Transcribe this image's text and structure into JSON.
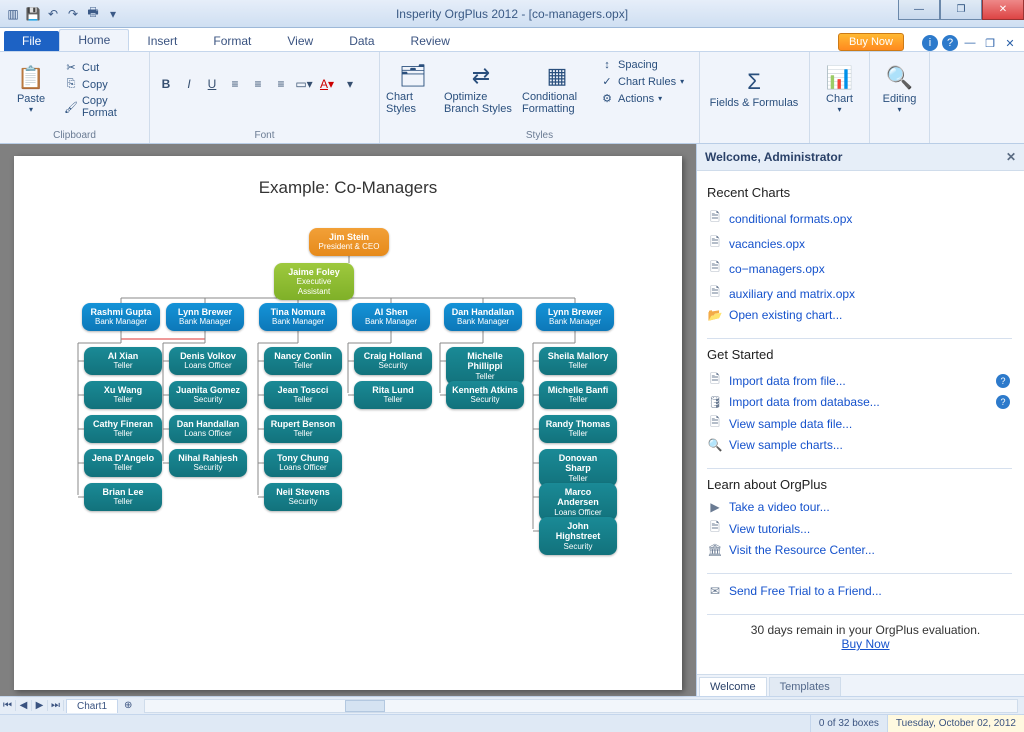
{
  "app_title": "Insperity OrgPlus 2012 - [co-managers.opx]",
  "qat": [
    "app",
    "save",
    "undo",
    "redo",
    "print"
  ],
  "menu": {
    "file": "File",
    "tabs": [
      "Home",
      "Insert",
      "Format",
      "View",
      "Data",
      "Review"
    ],
    "active": 0,
    "buy": "Buy Now"
  },
  "ribbon": {
    "clipboard": {
      "label": "Clipboard",
      "paste": "Paste",
      "cut": "Cut",
      "copy": "Copy",
      "copy_format": "Copy Format"
    },
    "font": {
      "label": "Font"
    },
    "styles": {
      "label": "Styles",
      "chart_styles": "Chart Styles",
      "optimize": "Optimize Branch Styles",
      "conditional": "Conditional Formatting",
      "spacing": "Spacing",
      "chart_rules": "Chart Rules",
      "actions": "Actions"
    },
    "fields": {
      "label": "Fields & Formulas"
    },
    "chart": {
      "label": "Chart"
    },
    "editing": {
      "label": "Editing"
    }
  },
  "chart_page": {
    "title": "Example: Co-Managers"
  },
  "chart_data": {
    "type": "org-chart",
    "root": {
      "name": "Jim Stein",
      "title": "President & CEO",
      "color": "orange"
    },
    "assistant": {
      "name": "Jaime Foley",
      "title": "Executive Assistant",
      "color": "green"
    },
    "managers": [
      {
        "name": "Rashmi Gupta",
        "title": "Bank Manager"
      },
      {
        "name": "Lynn Brewer",
        "title": "Bank Manager"
      },
      {
        "name": "Tina Nomura",
        "title": "Bank Manager"
      },
      {
        "name": "Al Shen",
        "title": "Bank Manager"
      },
      {
        "name": "Dan Handallan",
        "title": "Bank Manager"
      },
      {
        "name": "Lynn Brewer",
        "title": "Bank Manager"
      }
    ],
    "teams": [
      [
        {
          "name": "Al Xian",
          "title": "Teller"
        },
        {
          "name": "Xu Wang",
          "title": "Teller"
        },
        {
          "name": "Cathy Fineran",
          "title": "Teller"
        },
        {
          "name": "Jena D'Angelo",
          "title": "Teller"
        },
        {
          "name": "Brian Lee",
          "title": "Teller"
        }
      ],
      [
        {
          "name": "Denis Volkov",
          "title": "Loans Officer"
        },
        {
          "name": "Juanita Gomez",
          "title": "Security"
        },
        {
          "name": "Dan Handallan",
          "title": "Loans Officer"
        },
        {
          "name": "Nihal Rahjesh",
          "title": "Security"
        }
      ],
      [
        {
          "name": "Nancy Conlin",
          "title": "Teller"
        },
        {
          "name": "Jean Toscci",
          "title": "Teller"
        },
        {
          "name": "Rupert Benson",
          "title": "Teller"
        },
        {
          "name": "Tony Chung",
          "title": "Loans Officer"
        },
        {
          "name": "Neil Stevens",
          "title": "Security"
        }
      ],
      [
        {
          "name": "Craig Holland",
          "title": "Security"
        },
        {
          "name": "Rita Lund",
          "title": "Teller"
        }
      ],
      [
        {
          "name": "Michelle Phillippi",
          "title": "Teller"
        },
        {
          "name": "Kenneth Atkins",
          "title": "Security"
        }
      ],
      [
        {
          "name": "Sheila Mallory",
          "title": "Teller"
        },
        {
          "name": "Michelle Banfi",
          "title": "Teller"
        },
        {
          "name": "Randy Thomas",
          "title": "Teller"
        },
        {
          "name": "Donovan Sharp",
          "title": "Teller"
        },
        {
          "name": "Marco Andersen",
          "title": "Loans Officer"
        },
        {
          "name": "John Highstreet",
          "title": "Security"
        }
      ]
    ]
  },
  "panel": {
    "header": "Welcome, Administrator",
    "recent_h": "Recent Charts",
    "recent": [
      "conditional formats.opx",
      "vacancies.opx",
      "co−managers.opx",
      "auxiliary and matrix.opx"
    ],
    "open_existing": "Open existing chart...",
    "get_started_h": "Get Started",
    "get_started": [
      "Import data from file...",
      "Import data from database...",
      "View sample data file...",
      "View sample charts..."
    ],
    "learn_h": "Learn about OrgPlus",
    "learn": [
      "Take a video tour...",
      "View tutorials...",
      "Visit the Resource Center..."
    ],
    "send": "Send Free Trial to a Friend...",
    "trial_msg": "30 days remain in your OrgPlus evaluation.",
    "trial_link": "Buy Now",
    "tabs": [
      "Welcome",
      "Templates"
    ]
  },
  "sheet": {
    "tab": "Chart1"
  },
  "status": {
    "boxes": "0 of 32 boxes",
    "date": "Tuesday, October 02, 2012"
  }
}
